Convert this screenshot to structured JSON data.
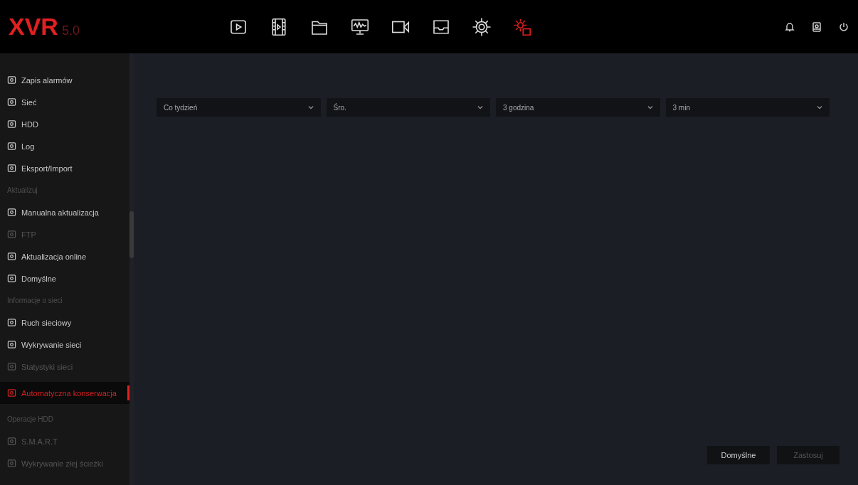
{
  "logo": {
    "brand": "XVR",
    "version": "5.0"
  },
  "toolbar": [
    {
      "selected": false
    },
    {
      "selected": false
    },
    {
      "selected": false
    },
    {
      "selected": false
    },
    {
      "selected": false
    },
    {
      "selected": false
    },
    {
      "selected": false
    },
    {
      "selected": true
    }
  ],
  "sidebar": [
    {
      "kind": "item",
      "label": "Zapis alarmów",
      "disabled": false,
      "selected": false
    },
    {
      "kind": "item",
      "label": "Sieć",
      "disabled": false,
      "selected": false
    },
    {
      "kind": "item",
      "label": "HDD",
      "disabled": false,
      "selected": false
    },
    {
      "kind": "item",
      "label": "Log",
      "disabled": false,
      "selected": false
    },
    {
      "kind": "item",
      "label": "Eksport/Import",
      "disabled": false,
      "selected": false
    },
    {
      "kind": "section",
      "label": "Aktualizuj"
    },
    {
      "kind": "item",
      "label": "Manualna aktualizacja",
      "disabled": false,
      "selected": false
    },
    {
      "kind": "item",
      "label": "FTP",
      "disabled": true,
      "selected": false
    },
    {
      "kind": "item",
      "label": "Aktualizacja online",
      "disabled": false,
      "selected": false
    },
    {
      "kind": "item",
      "label": "Domyślne",
      "disabled": false,
      "selected": false
    },
    {
      "kind": "section",
      "label": "Informacje o sieci"
    },
    {
      "kind": "item",
      "label": "Ruch sieciowy",
      "disabled": false,
      "selected": false
    },
    {
      "kind": "item",
      "label": "Wykrywanie sieci",
      "disabled": false,
      "selected": false
    },
    {
      "kind": "item",
      "label": "Statystyki sieci",
      "disabled": true,
      "selected": false
    },
    {
      "kind": "item",
      "label": "Automatyczna konserwacja",
      "disabled": false,
      "selected": true
    },
    {
      "kind": "section",
      "label": "Operacje HDD"
    },
    {
      "kind": "item",
      "label": "S.M.A.R.T",
      "disabled": true,
      "selected": false
    },
    {
      "kind": "item",
      "label": "Wykrywanie złej ścieżki",
      "disabled": true,
      "selected": false
    }
  ],
  "dropdowns": [
    {
      "value": "Co tydzień"
    },
    {
      "value": "Śro."
    },
    {
      "value": "3 godzina"
    },
    {
      "value": "3 min"
    }
  ],
  "buttons": [
    {
      "label": "Domyślne",
      "disabled": false
    },
    {
      "label": "Zastosuj",
      "disabled": true
    }
  ]
}
